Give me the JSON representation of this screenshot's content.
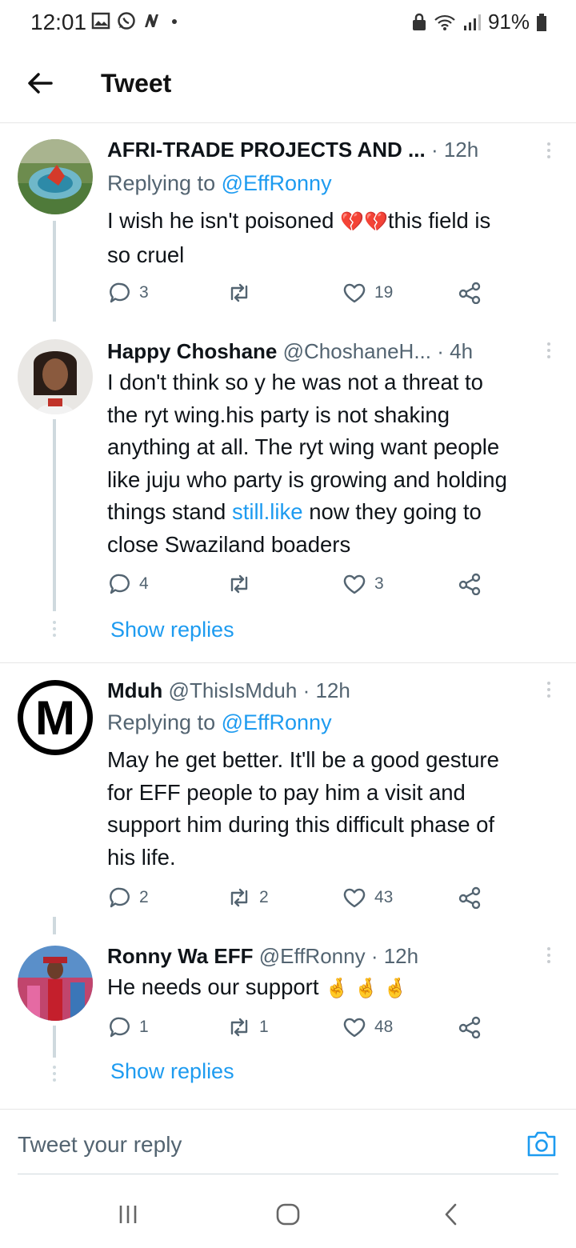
{
  "status_bar": {
    "time": "12:01",
    "battery": "91%"
  },
  "header": {
    "title": "Tweet"
  },
  "tweets": [
    {
      "name": "AFRI-TRADE PROJECTS AND ...",
      "handle": "",
      "time": "· 12h",
      "replying_prefix": "Replying to ",
      "replying_to": "@EffRonny",
      "text_a": "I wish he isn't poisoned ",
      "emoji_a": "💔💔",
      "text_b": "this field is",
      "text_c": "so cruel",
      "replies": "3",
      "retweets": "",
      "likes": "19"
    },
    {
      "name": "Happy Choshane",
      "handle": "@ChoshaneH...",
      "time": "· 4h",
      "lines": [
        "I don't think so y he was not a threat to",
        "the ryt wing.his party is not shaking",
        "anything at all. The ryt wing want people",
        "like juju who party is growing and holding"
      ],
      "line5_a": "things stand ",
      "line5_link": "still.like",
      "line5_b": " now they going to",
      "line6": "close Swaziland boaders",
      "replies": "4",
      "retweets": "",
      "likes": "3",
      "show_replies": "Show replies"
    },
    {
      "name": "Mduh",
      "handle": "@ThisIsMduh",
      "time": "· 12h",
      "avatar_letter": "M",
      "replying_prefix": "Replying to ",
      "replying_to": "@EffRonny",
      "lines": [
        "May he get better. It'll be a good gesture",
        "for EFF people to pay him a visit and",
        "support him during this difficult phase of",
        "his life."
      ],
      "replies": "2",
      "retweets": "2",
      "likes": "43"
    },
    {
      "name": "Ronny Wa EFF",
      "handle": "@EffRonny",
      "time": "· 12h",
      "text": "He needs our support ",
      "emoji": "🤞 🤞 🤞",
      "replies": "1",
      "retweets": "1",
      "likes": "48",
      "show_replies": "Show replies"
    }
  ],
  "reply_bar": {
    "placeholder": "Tweet your reply"
  },
  "icons": {
    "reply": "reply-icon",
    "retweet": "retweet-icon",
    "like": "heart-icon",
    "share": "share-icon",
    "camera": "camera-icon",
    "back": "arrow-left-icon"
  },
  "colors": {
    "link": "#1d9bf0",
    "secondary": "#536471",
    "text": "#0f1419"
  }
}
